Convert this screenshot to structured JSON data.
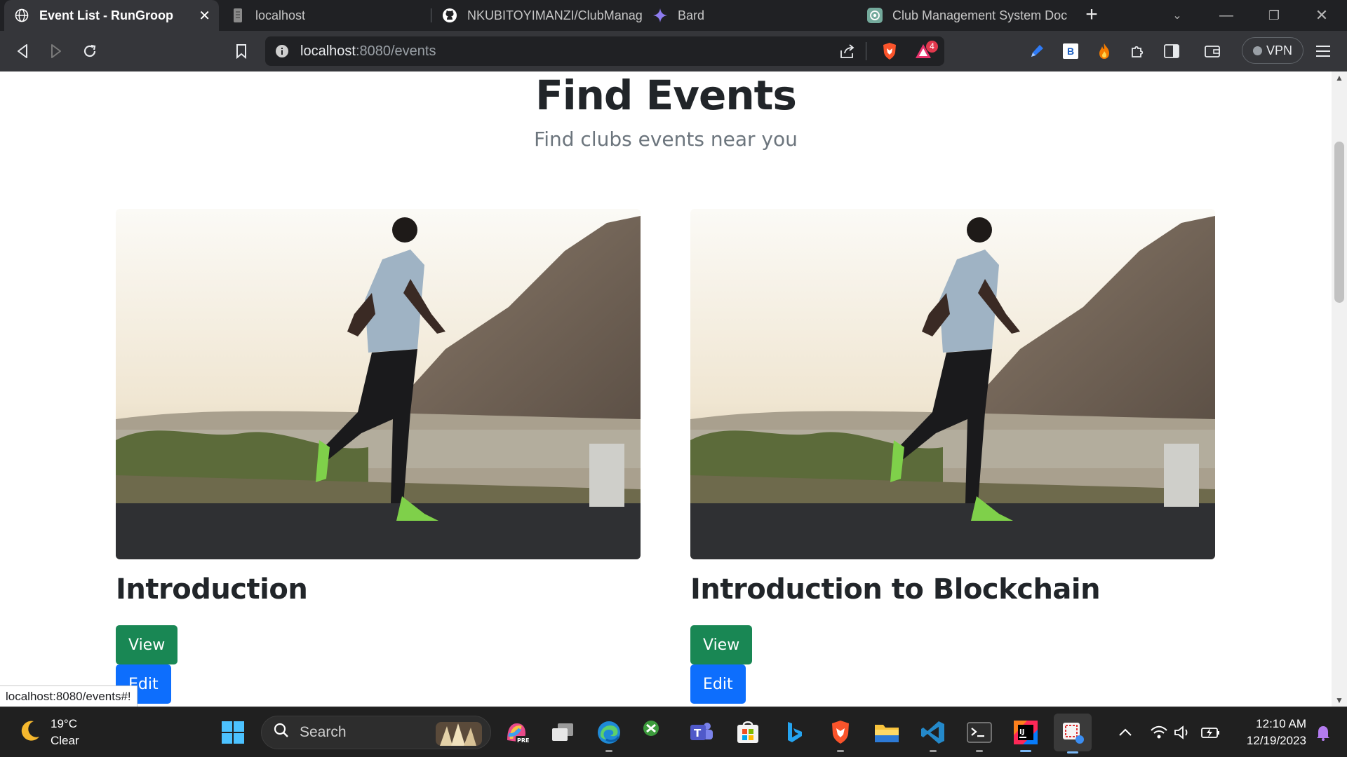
{
  "browser": {
    "tabs": [
      {
        "label": "Event List - RunGroop",
        "icon": "globe-icon",
        "active": true
      },
      {
        "label": "localhost",
        "icon": "page-icon",
        "active": false
      },
      {
        "label": "NKUBITOYIMANZI/ClubManage",
        "icon": "github-icon",
        "active": false
      },
      {
        "label": "Bard",
        "icon": "bard-sparkle-icon",
        "active": false
      },
      {
        "label": "Club Management System Doc",
        "icon": "chatgpt-icon",
        "active": false
      }
    ],
    "address": {
      "host": "localhost",
      "path": ":8080/events"
    },
    "brave_badge_count": "4",
    "extension_badge_letter": "B",
    "vpn_label": "VPN"
  },
  "page": {
    "title": "Find Events",
    "subtitle": "Find clubs events near you",
    "events": [
      {
        "title": "Introduction",
        "view_label": "View",
        "edit_label": "Edit",
        "image": "runner-on-mountain-road"
      },
      {
        "title": "Introduction to Blockchain",
        "view_label": "View",
        "edit_label": "Edit",
        "image": "runner-on-mountain-road"
      }
    ]
  },
  "status_url": "localhost:8080/events#!",
  "taskbar": {
    "weather_temp": "19°C",
    "weather_desc": "Clear",
    "search_placeholder": "Search",
    "time": "12:10 AM",
    "date": "12/19/2023"
  },
  "colors": {
    "view_button": "#198754",
    "edit_button": "#0d6efd",
    "heading": "#212529",
    "subtitle": "#6c757d"
  }
}
